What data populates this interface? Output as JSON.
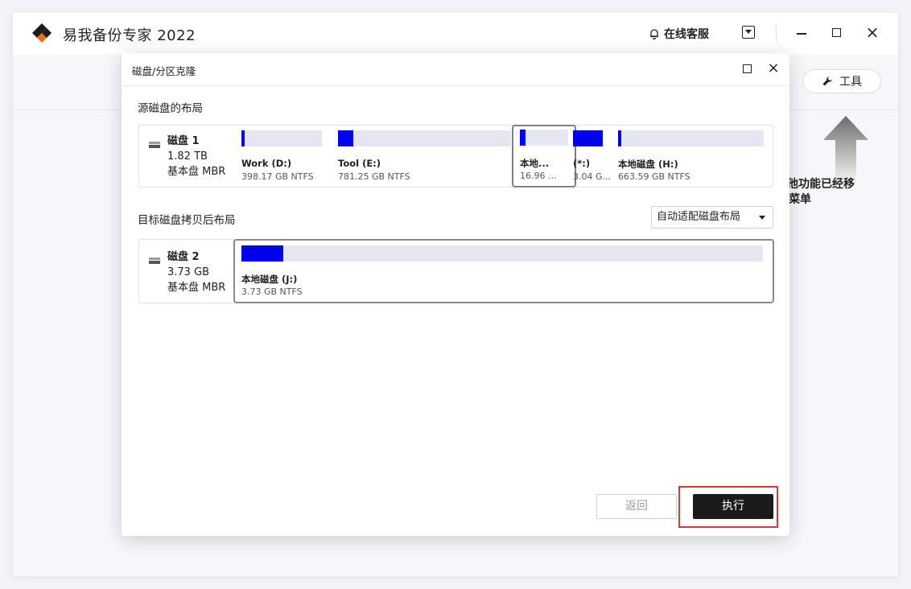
{
  "app": {
    "title": "易我备份专家 2022",
    "service_label": "在线客服",
    "tools_label": "工具",
    "hint_line1": "其他功能已经移",
    "hint_line2": "菜单"
  },
  "dialog": {
    "title": "磁盘/分区克隆",
    "source_label": "源磁盘的布局",
    "target_label": "目标磁盘拷贝后布局",
    "layout_select": "自动适配磁盘布局",
    "back_button": "返回",
    "execute_button": "执行"
  },
  "source_disk": {
    "name": "磁盘 1",
    "size": "1.82 TB",
    "type": "基本盘 MBR",
    "partitions": [
      {
        "name": "Work (D:)",
        "size": "398.17 GB NTFS",
        "used": 0.04
      },
      {
        "name": "Tool (E:)",
        "size": "781.25 GB NTFS",
        "used": 0.09
      },
      {
        "name": "本地...",
        "size": "16.96 ...",
        "used": 0.12,
        "selected": true
      },
      {
        "name": "(*:)",
        "size": "3.04 G...",
        "used": 1.0
      },
      {
        "name": "本地磁盘 (H:)",
        "size": "663.59 GB NTFS",
        "used": 0.02
      }
    ]
  },
  "target_disk": {
    "name": "磁盘 2",
    "size": "3.73 GB",
    "type": "基本盘 MBR",
    "partition": {
      "name": "本地磁盘 (J:)",
      "size": "3.73 GB NTFS",
      "used": 0.08
    }
  },
  "colors": {
    "used_fill": "#0000ee",
    "bar_bg": "#e4e7f0",
    "execute_bg": "#1a1a1a",
    "highlight": "#e0353b"
  }
}
